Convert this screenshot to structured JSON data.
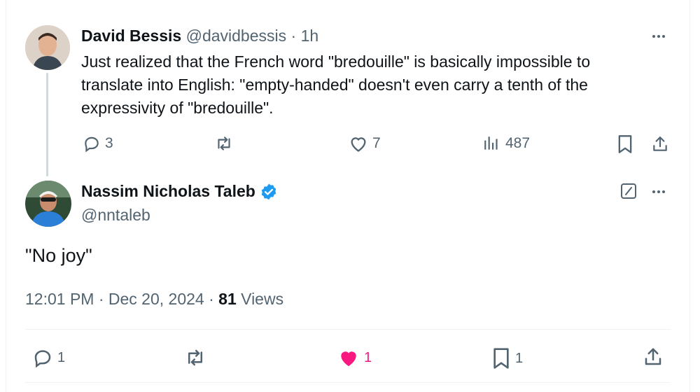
{
  "parent_tweet": {
    "author_name": "David Bessis",
    "handle": "@davidbessis",
    "separator": "·",
    "time_ago": "1h",
    "text_lines": [
      "Just realized that the French word \"bredouille\" is basically impossible to",
      "translate into English: \"empty-handed\" doesn't even carry a tenth of the",
      "expressivity of \"bredouille\"."
    ],
    "actions": {
      "replies": "3",
      "reposts": "",
      "likes": "7",
      "views": "487"
    }
  },
  "reply_tweet": {
    "author_name": "Nassim Nicholas Taleb",
    "handle": "@nntaleb",
    "verified": true,
    "text": "\"No joy\"",
    "timestamp": "12:01 PM · Dec 20, 2024 · ",
    "views_count": "81",
    "views_label": " Views",
    "actions": {
      "replies": "1",
      "reposts": "",
      "likes": "1",
      "bookmarks": "1"
    }
  },
  "colors": {
    "text": "#0f1419",
    "muted": "#536471",
    "verified": "#1d9bf0",
    "like_active": "#f91880",
    "border": "#eff3f4"
  },
  "icons": [
    "reply-icon",
    "repost-icon",
    "like-icon",
    "views-icon",
    "bookmark-icon",
    "share-icon",
    "more-icon",
    "verified-badge-icon",
    "edit-icon"
  ]
}
